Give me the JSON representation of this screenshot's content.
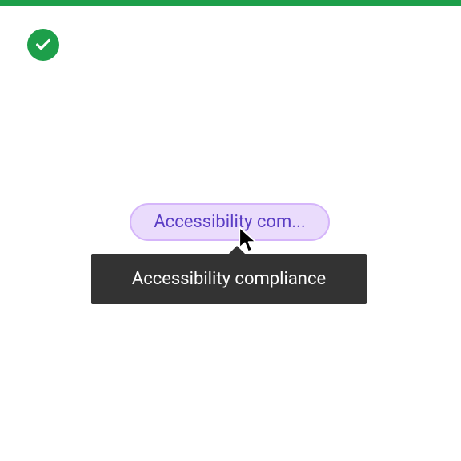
{
  "pill": {
    "truncated_label": "Accessibility com..."
  },
  "tooltip": {
    "text": "Accessibility compliance"
  }
}
